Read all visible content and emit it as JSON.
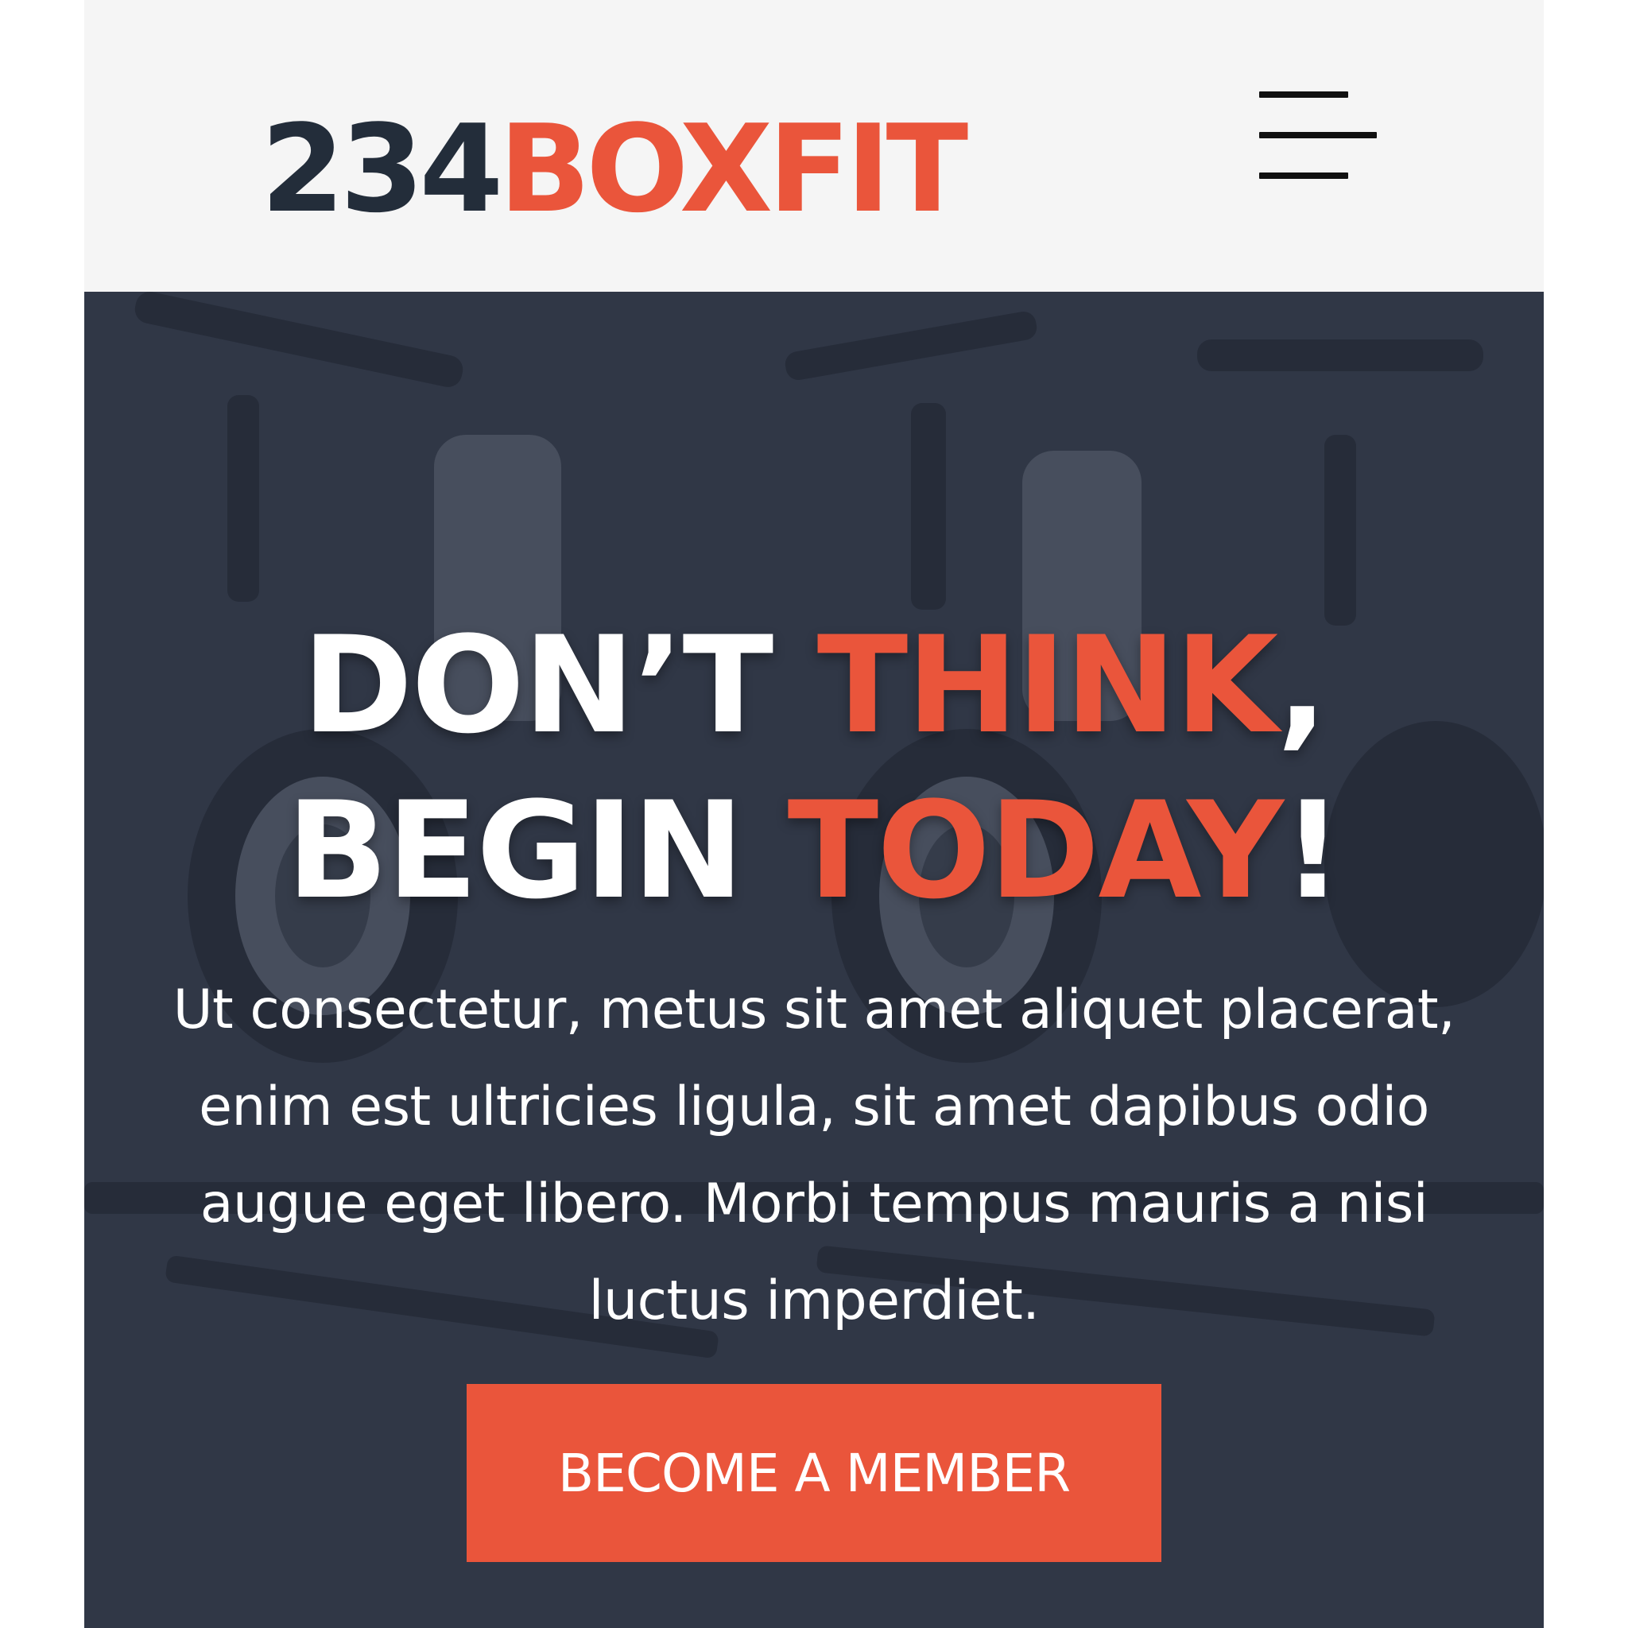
{
  "header": {
    "logo": {
      "number_part": "234",
      "word_part": "BOXFIT"
    },
    "menu_icon": "hamburger-menu-icon"
  },
  "hero": {
    "headline": {
      "line1_white": "DON’T ",
      "line1_accent": "THINK",
      "line1_suffix": ",",
      "line2_white": "BEGIN ",
      "line2_accent": "TODAY",
      "line2_suffix": "!"
    },
    "lead_text": "Ut consectetur, metus sit amet aliquet placerat, enim est ultricies ligula, sit amet dapibus odio augue eget libero. Morbi tempus mauris a nisi luctus imperdiet.",
    "cta_label": "BECOME A MEMBER",
    "background_image": "gym-spin-bikes-photo"
  },
  "colors": {
    "accent": "#ea553b",
    "dark_navy": "#232d3a",
    "hero_overlay": "#303746",
    "header_bg": "#f5f5f5",
    "text_light": "#ffffff"
  }
}
